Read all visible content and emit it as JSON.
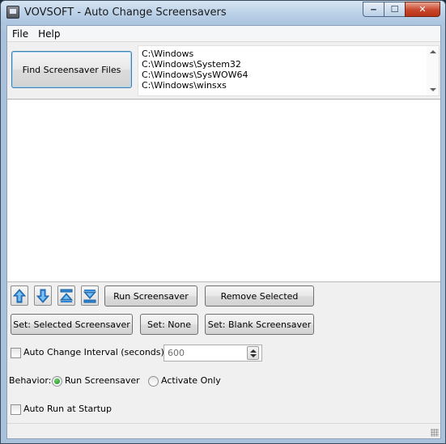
{
  "window": {
    "title": "VOVSOFT - Auto Change Screensavers",
    "min_glyph": "‒",
    "max_glyph": "☐",
    "close_glyph": "✕"
  },
  "menu": [
    "File",
    "Help"
  ],
  "top": {
    "find_button": "Find Screensaver Files",
    "folders": [
      "C:\\Windows",
      "C:\\Windows\\System32",
      "C:\\Windows\\SysWOW64",
      "C:\\Windows\\winsxs"
    ]
  },
  "toolbar": {
    "icons": [
      "arrow-up-icon",
      "arrow-down-icon",
      "move-top-icon",
      "move-bottom-icon"
    ],
    "run_screensaver": "Run Screensaver",
    "remove_selected": "Remove Selected",
    "set_selected": "Set: Selected Screensaver",
    "set_none": "Set: None",
    "set_blank": "Set: Blank Screensaver"
  },
  "options": {
    "auto_change_label": "Auto Change Interval (seconds):",
    "auto_change_checked": false,
    "interval_value": "600",
    "behavior_label": "Behavior:",
    "behavior_run": "Run Screensaver",
    "behavior_activate": "Activate Only",
    "behavior_selected": "Run Screensaver",
    "auto_run_label": "Auto Run at Startup",
    "auto_run_checked": false
  },
  "colors": {
    "arrow_blue": "#2f86d6",
    "arrow_blue_light": "#7dc0f5"
  }
}
